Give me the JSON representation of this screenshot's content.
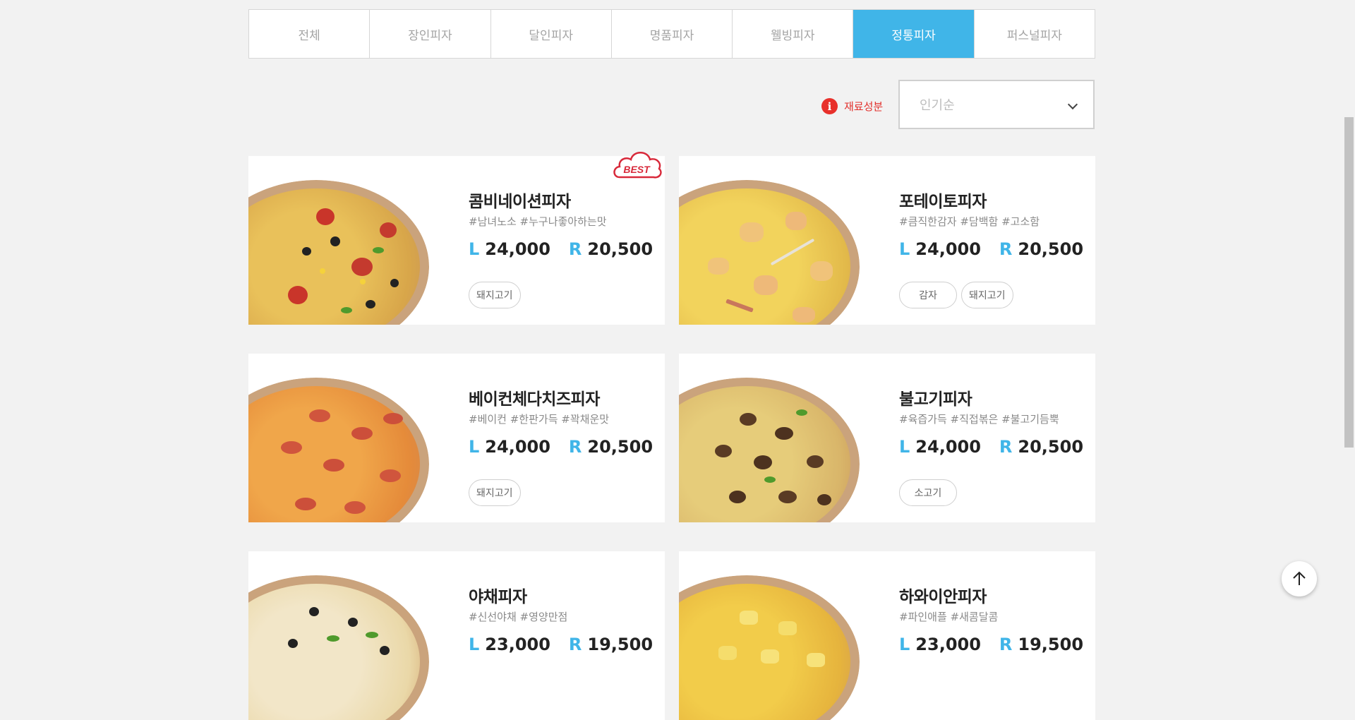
{
  "tabs": [
    {
      "label": "전체"
    },
    {
      "label": "장인피자"
    },
    {
      "label": "달인피자"
    },
    {
      "label": "명품피자"
    },
    {
      "label": "웰빙피자"
    },
    {
      "label": "정통피자"
    },
    {
      "label": "퍼스널피자"
    }
  ],
  "active_tab": "정통피자",
  "filter": {
    "ingredient_label": "재료성분",
    "sort_value": "인기순"
  },
  "best_badge": "BEST",
  "products": [
    {
      "name": "콤비네이션피자",
      "tags": "#남녀노소 #누구나좋아하는맛",
      "l_label": "L",
      "l_price": "24,000",
      "r_label": "R",
      "r_price": "20,500",
      "chips": [
        "돼지고기"
      ]
    },
    {
      "name": "포테이토피자",
      "tags": "#큼직한감자 #담백함 #고소함",
      "l_label": "L",
      "l_price": "24,000",
      "r_label": "R",
      "r_price": "20,500",
      "chips": [
        "감자",
        "돼지고기"
      ]
    },
    {
      "name": "베이컨체다치즈피자",
      "tags": "#베이컨 #한판가득 #꽉채운맛",
      "l_label": "L",
      "l_price": "24,000",
      "r_label": "R",
      "r_price": "20,500",
      "chips": [
        "돼지고기"
      ]
    },
    {
      "name": "불고기피자",
      "tags": "#육즙가득 #직접볶은 #불고기듬뿍",
      "l_label": "L",
      "l_price": "24,000",
      "r_label": "R",
      "r_price": "20,500",
      "chips": [
        "소고기"
      ]
    },
    {
      "name": "야채피자",
      "tags": "#신선야채 #영양만점",
      "l_label": "L",
      "l_price": "23,000",
      "r_label": "R",
      "r_price": "19,500",
      "chips": []
    },
    {
      "name": "하와이안피자",
      "tags": "#파인애플 #새콤달콤",
      "l_label": "L",
      "l_price": "23,000",
      "r_label": "R",
      "r_price": "19,500",
      "chips": []
    }
  ],
  "colors": {
    "accent": "#40b5e8",
    "alert": "#e8302b",
    "page_bg": "#f2f2f2"
  },
  "icons": {
    "info": "info-icon",
    "chevron": "chevron-down-icon",
    "to_top": "arrow-up-icon"
  }
}
